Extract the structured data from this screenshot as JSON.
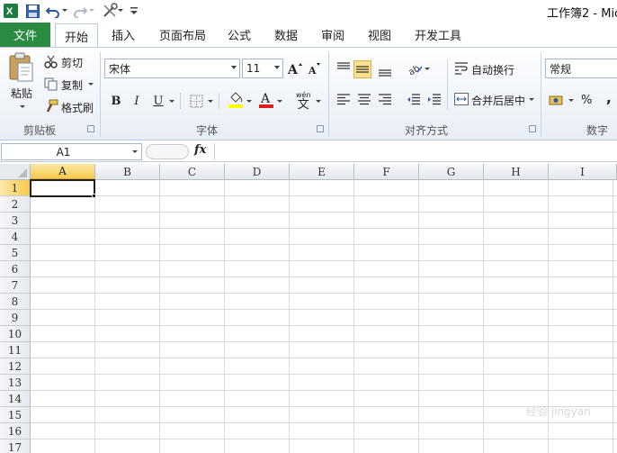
{
  "window": {
    "title": "工作簿2 - Mic"
  },
  "quick_access": {
    "icons": [
      "excel-logo-icon",
      "save-icon",
      "undo-icon",
      "redo-icon",
      "customize-icon"
    ]
  },
  "tabs": {
    "file": "文件",
    "home": "开始",
    "insert": "插入",
    "page_layout": "页面布局",
    "formulas": "公式",
    "data": "数据",
    "review": "审阅",
    "view": "视图",
    "developer": "开发工具"
  },
  "clipboard": {
    "paste": "粘贴",
    "cut": "剪切",
    "copy": "复制",
    "format_painter": "格式刷",
    "group": "剪贴板"
  },
  "font": {
    "name": "宋体",
    "size": "11",
    "bold": "B",
    "italic": "I",
    "underline": "U",
    "group": "字体",
    "color_accent": "#e02020",
    "fill_accent": "#ffff00",
    "phonetic": "wén"
  },
  "alignment": {
    "wrap_text": "自动换行",
    "merge_center": "合并后居中",
    "group": "对齐方式"
  },
  "number": {
    "format": "常规",
    "percent": "%",
    "comma": ",",
    "group": "数字"
  },
  "formula_bar": {
    "name_box": "A1",
    "fx": "fx",
    "content": ""
  },
  "grid": {
    "columns": [
      "A",
      "B",
      "C",
      "D",
      "E",
      "F",
      "G",
      "H",
      "I"
    ],
    "rows": [
      "1",
      "2",
      "3",
      "4",
      "5",
      "6",
      "7",
      "8",
      "9",
      "10",
      "11",
      "12",
      "13",
      "14",
      "15",
      "16",
      "17"
    ],
    "selected_cell": "A1"
  },
  "watermark": "经验 jingyan"
}
